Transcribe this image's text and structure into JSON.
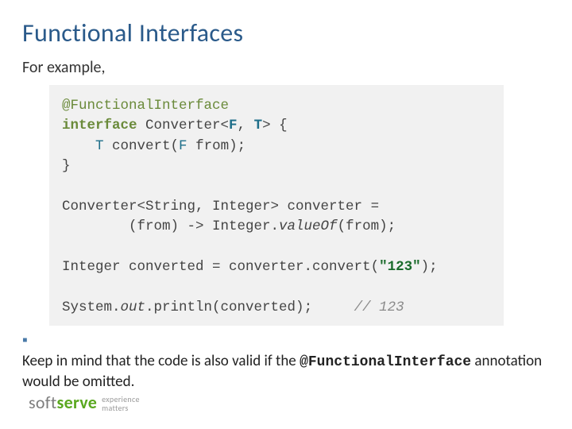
{
  "title": "Functional Interfaces",
  "intro": "For example,",
  "code": {
    "l1": "@FunctionalInterface",
    "l2a": "interface",
    "l2b": " Converter<",
    "l2c": "F",
    "l2d": ", ",
    "l2e": "T",
    "l2f": "> {",
    "l3a": "    ",
    "l3b": "T",
    "l3c": " convert(",
    "l3d": "F",
    "l3e": " from);",
    "l4": "}",
    "l6": "Converter<String, Integer> converter =",
    "l7a": "        (from) -> Integer.",
    "l7b": "valueOf",
    "l7c": "(from);",
    "l9a": "Integer converted = converter.convert(",
    "l9b": "\"123\"",
    "l9c": ");",
    "l11a": "System.",
    "l11b": "out",
    "l11c": ".println(converted);     ",
    "l11d": "// 123"
  },
  "note_pre": "Keep in mind that the code is also valid if the ",
  "note_code": "@FunctionalInterface",
  "note_post": " annotation would be omitted.",
  "logo": {
    "soft": "soft",
    "serve": "serve",
    "tag1": "experience",
    "tag2": "matters"
  }
}
